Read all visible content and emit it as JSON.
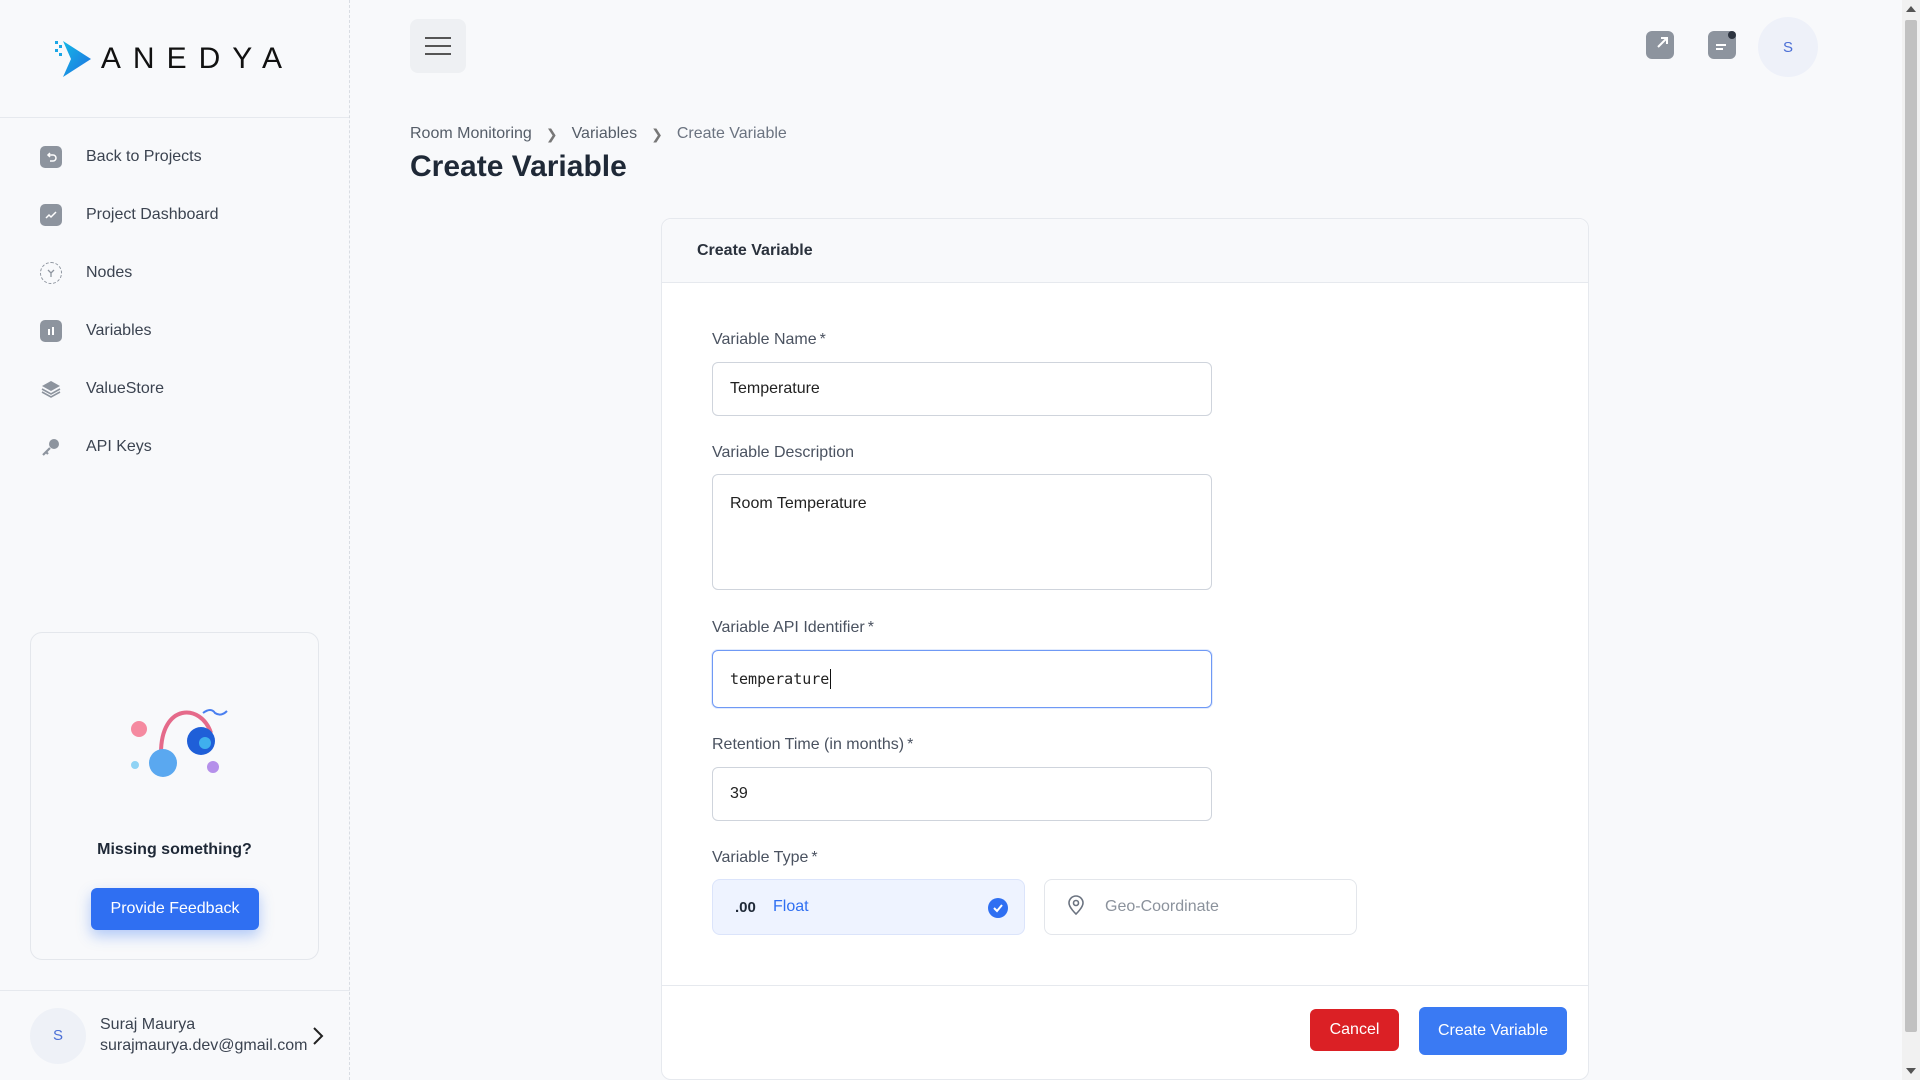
{
  "brand": {
    "name": "ANEDYA",
    "accent": "#2f6ff2",
    "danger": "#db2025"
  },
  "sidebar": {
    "items": [
      {
        "label": "Back to Projects",
        "icon": "back-arrow-icon"
      },
      {
        "label": "Project Dashboard",
        "icon": "chart-icon"
      },
      {
        "label": "Nodes",
        "icon": "nodes-icon"
      },
      {
        "label": "Variables",
        "icon": "bar-chart-icon"
      },
      {
        "label": "ValueStore",
        "icon": "layers-icon"
      },
      {
        "label": "API Keys",
        "icon": "key-icon"
      }
    ],
    "feedback": {
      "title": "Missing something?",
      "button": "Provide Feedback"
    },
    "user": {
      "initial": "S",
      "name": "Suraj Maurya",
      "email": "surajmaurya.dev@gmail.com"
    }
  },
  "topbar": {
    "avatar_initial": "S"
  },
  "breadcrumb": [
    "Room Monitoring",
    "Variables",
    "Create Variable"
  ],
  "page_title": "Create Variable",
  "form": {
    "card_title": "Create Variable",
    "name": {
      "label": "Variable Name",
      "required": "*",
      "value": "Temperature"
    },
    "description": {
      "label": "Variable Description",
      "value": "Room Temperature"
    },
    "identifier": {
      "label": "Variable API Identifier",
      "required": "*",
      "value": "temperature"
    },
    "retention": {
      "label": "Retention Time (in months)",
      "required": "*",
      "value": "39"
    },
    "type": {
      "label": "Variable Type",
      "required": "*",
      "options": [
        {
          "label": "Float",
          "icon_text": ".00",
          "selected": true
        },
        {
          "label": "Geo-Coordinate",
          "selected": false
        }
      ]
    },
    "cancel": "Cancel",
    "submit": "Create Variable"
  }
}
